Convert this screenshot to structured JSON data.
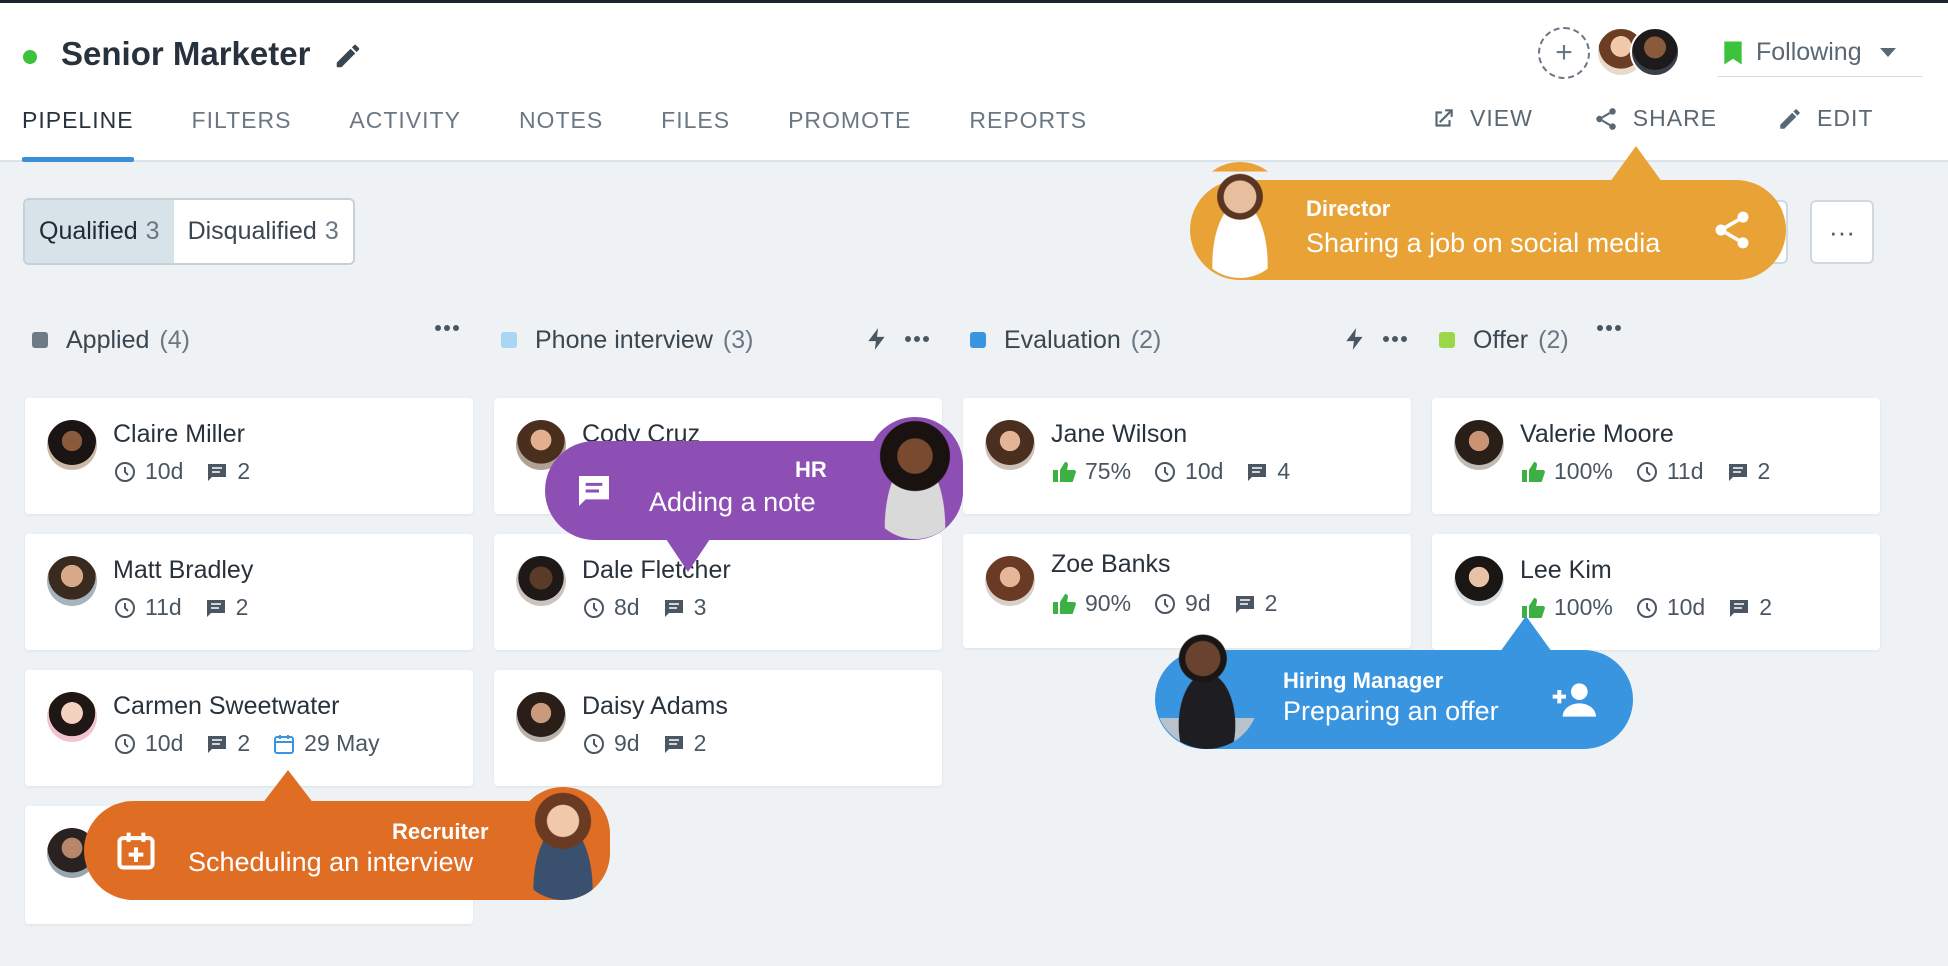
{
  "header": {
    "job_title": "Senior Marketer",
    "follow_label": "Following"
  },
  "tabs": [
    "PIPELINE",
    "FILTERS",
    "ACTIVITY",
    "NOTES",
    "FILES",
    "PROMOTE",
    "REPORTS"
  ],
  "actions": {
    "view": "VIEW",
    "share": "SHARE",
    "edit": "EDIT"
  },
  "segment": {
    "qualified_label": "Qualified",
    "qualified_count": "3",
    "disqualified_label": "Disqualified",
    "disqualified_count": "3"
  },
  "more_label": "···",
  "columns": [
    {
      "name": "Applied",
      "count": "(4)",
      "color": "#6e7b86"
    },
    {
      "name": "Phone interview",
      "count": "(3)",
      "color": "#a9d6f5"
    },
    {
      "name": "Evaluation",
      "count": "(2)",
      "color": "#3a95e0"
    },
    {
      "name": "Offer",
      "count": "(2)",
      "color": "#9ad84a"
    }
  ],
  "cards": {
    "claire": {
      "name": "Claire Miller",
      "time": "10d",
      "notes": "2"
    },
    "matt": {
      "name": "Matt Bradley",
      "time": "11d",
      "notes": "2"
    },
    "carmen": {
      "name": "Carmen Sweetwater",
      "time": "10d",
      "notes": "2",
      "date": "29 May"
    },
    "cody": {
      "name": "Cody Cruz"
    },
    "dale": {
      "name": "Dale Fletcher",
      "time": "8d",
      "notes": "3"
    },
    "daisy": {
      "name": "Daisy Adams",
      "time": "9d",
      "notes": "2"
    },
    "jane": {
      "name": "Jane Wilson",
      "score": "75%",
      "time": "10d",
      "notes": "4"
    },
    "zoe": {
      "name": "Zoe Banks",
      "score": "90%",
      "time": "9d",
      "notes": "2"
    },
    "valerie": {
      "name": "Valerie Moore",
      "score": "100%",
      "time": "11d",
      "notes": "2"
    },
    "lee": {
      "name": "Lee Kim",
      "score": "100%",
      "time": "10d",
      "notes": "2"
    }
  },
  "bubbles": {
    "director": {
      "role": "Director",
      "action": "Sharing a job on social media",
      "color": "#e8a236"
    },
    "hr": {
      "role": "HR",
      "action": "Adding a note",
      "color": "#8e4fb5"
    },
    "hiring": {
      "role": "Hiring Manager",
      "action": "Preparing an offer",
      "color": "#3a95e0"
    },
    "recruiter": {
      "role": "Recruiter",
      "action": "Scheduling an interview",
      "color": "#e06d24"
    }
  }
}
